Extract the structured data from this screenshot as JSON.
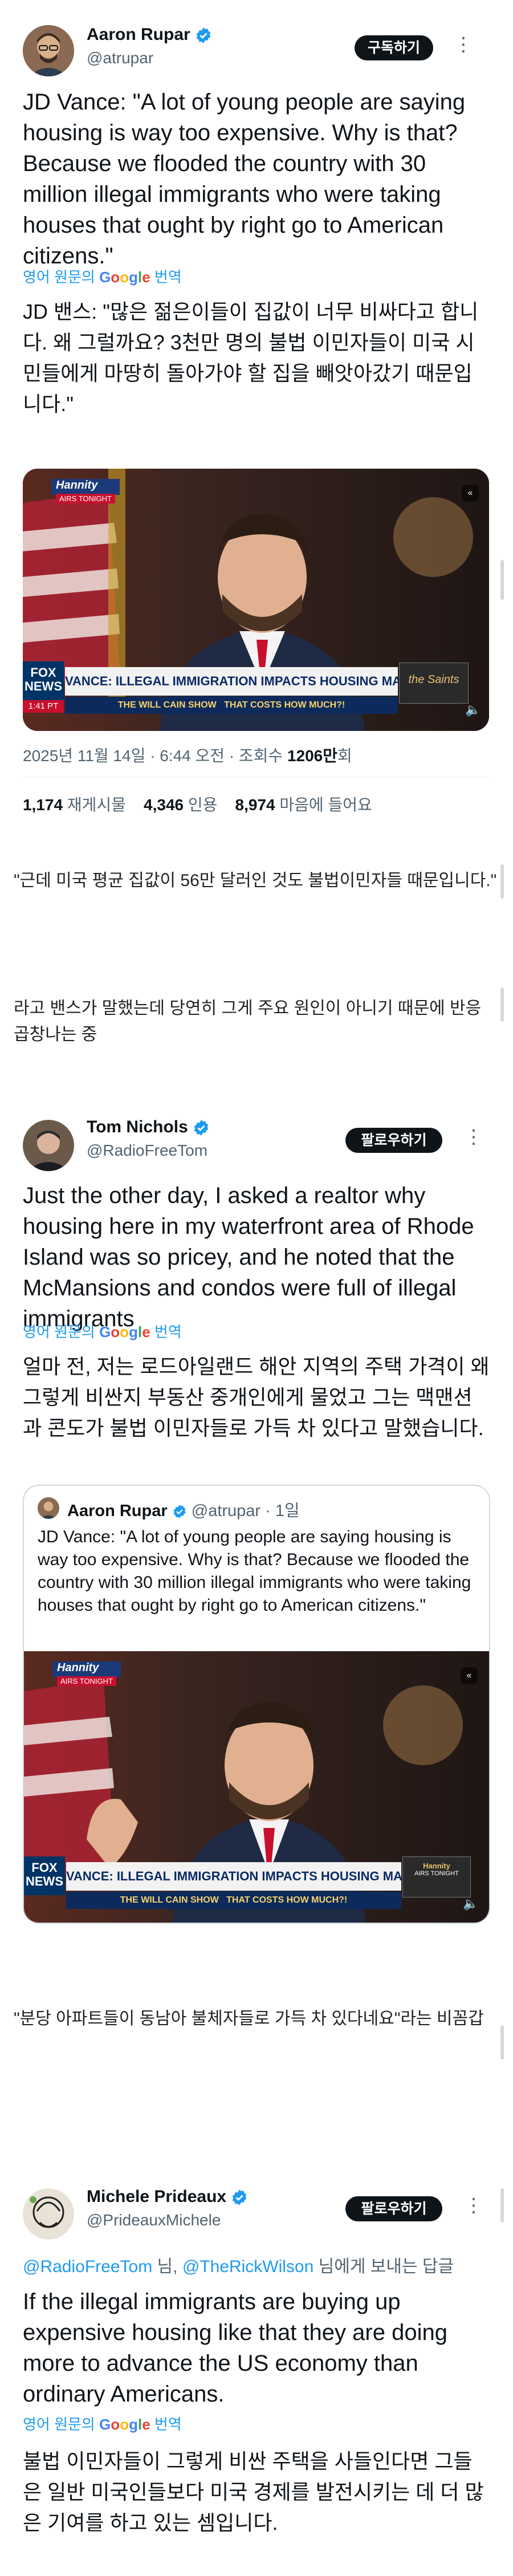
{
  "tweet1": {
    "name": "Aaron Rupar",
    "handle": "@atrupar",
    "button": "구독하기",
    "text": "JD Vance: \"A lot of young people are saying housing is way too expensive. Why is that? Because we flooded the country with 30 million illegal immigrants who were taking houses that ought by right go to American citizens.\"",
    "translate_prefix": "영어 원문의",
    "translate_suffix": "번역",
    "translation": "JD 밴스: \"많은 젊은이들이 집값이 너무 비싸다고 합니다. 왜 그럴까요? 3천만 명의 불법 이민자들이 미국 시민들에게 마땅히 돌아가야 할 집을 빼앗아갔기 때문입니다.\"",
    "video": {
      "show": "Hannity",
      "airs": "AIRS TONIGHT",
      "network": "FOX NEWS",
      "time": "1:41 PT",
      "headline": "VANCE: ILLEGAL IMMIGRATION IMPACTS HOUSING MARKET",
      "ticker": "THE WILL CAIN SHOW   THAT COSTS HOW MUCH?!",
      "promo": "the Saints"
    },
    "timestamp": "2025년 11월 14일 · 6:44 오전 · 조회수",
    "views": "1206만",
    "views_suffix": "회",
    "retweets": "1,174",
    "retweets_label": "재게시물",
    "quotes": "4,346",
    "quotes_label": "인용",
    "likes": "8,974",
    "likes_label": "마음에 들어요"
  },
  "comment1": "\"근데 미국 평균 집값이 56만 달러인 것도 불법이민자들 때문입니다.\"",
  "comment2": "라고 밴스가 말했는데 당연히 그게 주요 원인이 아니기 때문에 반응 곱창나는 중",
  "tweet2": {
    "name": "Tom Nichols",
    "handle": "@RadioFreeTom",
    "button": "팔로우하기",
    "text": "Just the other day, I asked a realtor why housing here in my waterfront area of Rhode Island was so pricey, and he noted that the McMansions and condos were full of illegal immigrants",
    "translate_prefix": "영어 원문의",
    "translate_suffix": "번역",
    "translation": "얼마 전, 저는 로드아일랜드 해안 지역의 주택 가격이 왜 그렇게 비싼지 부동산 중개인에게 물었고 그는 맥맨션과 콘도가 불법 이민자들로 가득 차 있다고 말했습니다.",
    "quote": {
      "name": "Aaron Rupar",
      "handle": "@atrupar · 1일",
      "text": "JD Vance: \"A lot of young people are saying housing is way too expensive. Why is that? Because we flooded the country with 30 million illegal immigrants who were taking houses that ought by right go to American citizens.\"",
      "headline": "VANCE: ILLEGAL IMMIGRATION IMPACTS HOUSING MARKET"
    }
  },
  "comment3": "\"분당 아파트들이 동남아 불체자들로 가득 차 있다네요\"라는 비꼼갑",
  "tweet3": {
    "name": "Michele Prideaux",
    "handle": "@PrideauxMichele",
    "button": "팔로우하기",
    "reply_mention1": "@RadioFreeTom",
    "reply_mid": " 님, ",
    "reply_mention2": "@TheRickWilson",
    "reply_end": " 님에게 보내는 답글",
    "text": "If the illegal immigrants are buying up expensive housing like that they are doing more to advance the US economy than ordinary Americans.",
    "translate_prefix": "영어 원문의",
    "translate_suffix": "번역",
    "translation": "불법 이민자들이 그렇게 비싼 주택을 사들인다면 그들은 일반 미국인들보다 미국 경제를 발전시키는 데 더 많은 기여를 하고 있는 셈입니다."
  },
  "colors": {
    "accent": "#1d9bf0",
    "text": "#0f1419",
    "muted": "#536471",
    "fox_red": "#c8102e",
    "fox_blue": "#003366"
  }
}
